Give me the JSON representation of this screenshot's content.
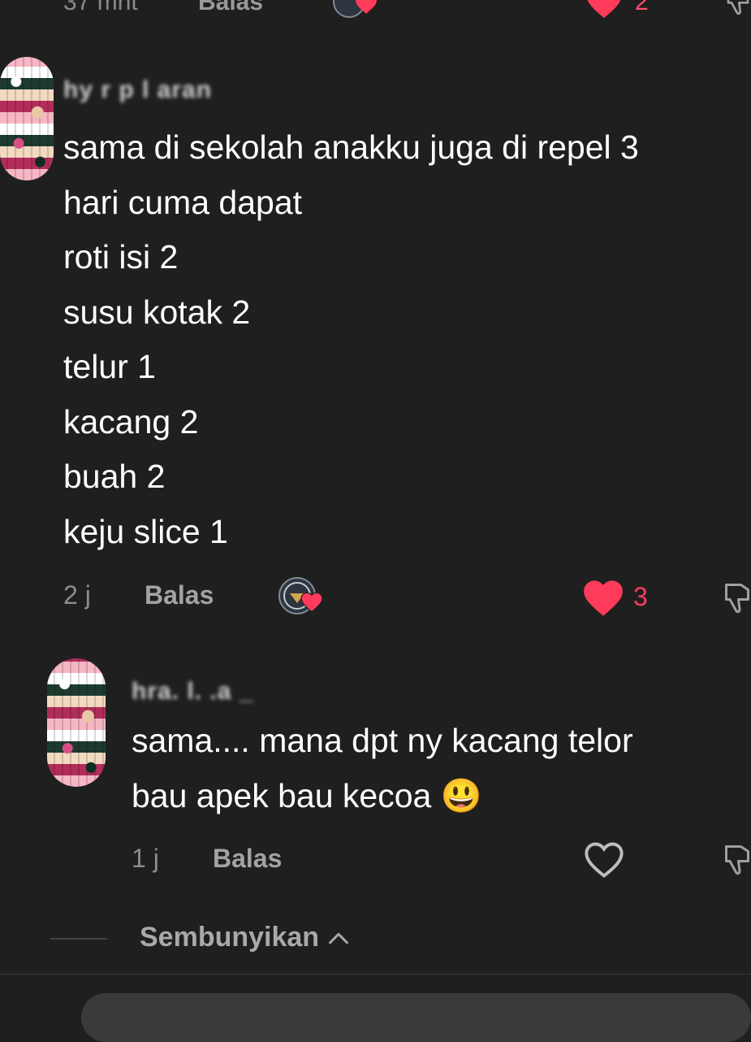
{
  "top_partial": {
    "time": "37 mnt",
    "reply": "Balas",
    "like_count": "2"
  },
  "comments": [
    {
      "username": "hy  r   p  l  aran",
      "text": "sama di sekolah anakku juga di repel 3\nhari cuma dapat\nroti isi 2\nsusu kotak 2\ntelur 1\nkacang 2\nbuah 2\nkeju slice 1",
      "time": "2 j",
      "reply": "Balas",
      "like_count": "3",
      "liked": true,
      "creator_liked": true
    },
    {
      "username": "hra. l. .a _",
      "text": "sama.... mana dpt ny kacang telor\nbau apek bau kecoa 😃",
      "time": "1 j",
      "reply": "Balas",
      "like_count": "",
      "liked": false
    }
  ],
  "hide_replies": "Sembunyikan",
  "colors": {
    "background": "#1f1f1f",
    "like": "#ff3b5c",
    "secondary_text": "#9a9a9a"
  },
  "icons": {
    "heart_filled": "heart-filled-icon",
    "heart_outline": "heart-outline-icon",
    "dislike": "thumbs-down-icon",
    "chevron": "chevron-up-icon"
  }
}
